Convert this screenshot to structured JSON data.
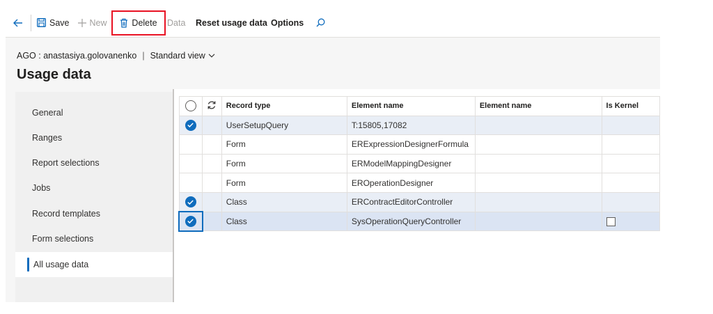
{
  "toolbar": {
    "save_label": "Save",
    "new_label": "New",
    "delete_label": "Delete",
    "data_label": "Data",
    "reset_label": "Reset usage data",
    "options_label": "Options"
  },
  "breadcrumb": {
    "context": "AGO : anastasiya.golovanenko",
    "separator": "|",
    "view": "Standard view"
  },
  "page_title": "Usage data",
  "sidebar": {
    "items": [
      {
        "label": "General"
      },
      {
        "label": "Ranges"
      },
      {
        "label": "Report selections"
      },
      {
        "label": "Jobs"
      },
      {
        "label": "Record templates"
      },
      {
        "label": "Form selections"
      },
      {
        "label": "All usage data",
        "selected": true
      }
    ]
  },
  "grid": {
    "columns": [
      "Record type",
      "Element name",
      "Element name",
      "Is Kernel"
    ],
    "rows": [
      {
        "record_type": "UserSetupQuery",
        "element_name": "T:15805,17082",
        "element_name_2": "",
        "checked": true,
        "is_kernel": null
      },
      {
        "record_type": "Form",
        "element_name": "ERExpressionDesignerFormula",
        "element_name_2": "",
        "checked": false,
        "is_kernel": null
      },
      {
        "record_type": "Form",
        "element_name": "ERModelMappingDesigner",
        "element_name_2": "",
        "checked": false,
        "is_kernel": null
      },
      {
        "record_type": "Form",
        "element_name": "EROperationDesigner",
        "element_name_2": "",
        "checked": false,
        "is_kernel": null
      },
      {
        "record_type": "Class",
        "element_name": "ERContractEditorController",
        "element_name_2": "",
        "checked": true,
        "is_kernel": null
      },
      {
        "record_type": "Class",
        "element_name": "SysOperationQueryController",
        "element_name_2": "",
        "checked": true,
        "is_kernel": false
      }
    ]
  },
  "colors": {
    "accent": "#0f6cbd",
    "highlight_box": "#e81123",
    "selected_row": "#e9eef6"
  },
  "icons": [
    "back-arrow-icon",
    "save-icon",
    "plus-icon",
    "trash-icon",
    "search-icon",
    "chevron-down-icon",
    "refresh-icon",
    "checkmark-icon"
  ]
}
